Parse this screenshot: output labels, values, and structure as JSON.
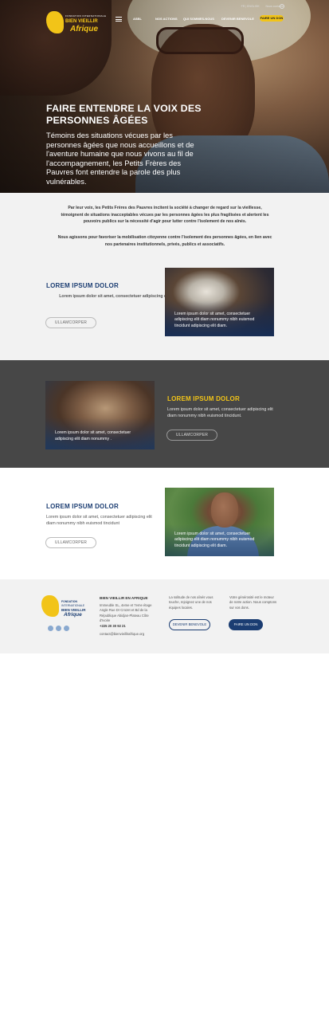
{
  "header": {
    "top_links": [
      "FR | ENGLISH",
      "Nous contacter"
    ],
    "logo": {
      "line1": "FONDATION INTERNATIONALE",
      "line2": "BIEN VIEILLIR",
      "line3": "Afrique"
    },
    "nav": [
      "ASBL",
      "NOS ACTIONS",
      "QUI SOMMES-NOUS",
      "DEVENIR BENEVOLE"
    ],
    "cta": "FAIRE UN DON"
  },
  "hero": {
    "title": "FAIRE ENTENDRE LA VOIX DES PERSONNES ÂGÉES",
    "text": "Témoins des situations vécues par les personnes âgées que nous accueillons et de l'aventure humaine que nous vivons au fil de l'accompagnement, les Petits Frères des Pauvres font entendre la parole des plus vulnérables."
  },
  "intro": {
    "p1": "Par leur voix, les Petits Frères des Pauvres incitent la société à changer de regard sur la vieillesse, témoignent de situations inacceptables vécues par les personnes âgées les plus fragilisées et alertent les pouvoirs publics sur la nécessité d'agir pour lutter contre l'isolement de nos aînés.",
    "p2": "Nous agissons pour favoriser la mobilisation citoyenne contre l'isolement des personnes âgées, en lien avec nos partenaires institutionnels, privés, publics et associatifs."
  },
  "sections": [
    {
      "title": "LOREM IPSUM DOLOR",
      "text": "Lorem ipsum dolor sit amet, consectetuer adipiscing elit diam nonummy nibh euismod tincidunt",
      "button": "ULLAMCORPER",
      "caption": "Lorem ipsum dolor sit amet, consectetuer adipiscing elit diam nonummy nibh euismod tincidunt adipiscing elit diam."
    },
    {
      "title": "LOREM IPSUM DOLOR",
      "text": "Lorem ipsum dolor sit amet, consectetuer adipiscing elit diam nonummy nibh euismod tincidunt.",
      "button": "ULLAMCORPER",
      "caption": "Lorem ipsum dolor sit amet, consectetuer adipiscing elit diam nonummy ."
    },
    {
      "title": "LOREM IPSUM DOLOR",
      "text": "Lorem ipsum dolor sit amet, consectetuer adipiscing elit diam nonummy nibh euismod tincidunt",
      "button": "ULLAMCORPER",
      "caption": "Lorem ipsum dolor sit amet, consectetuer adipiscing elit diam nonummy nibh euismod tincidunt adipiscing elit diam."
    }
  ],
  "footer": {
    "logo": {
      "line1": "FONDATION",
      "line1b": "INTERNATIONALE",
      "line2": "BIEN VIEILLIR",
      "line3": "Afrique"
    },
    "name": "BIEN VIEILLIR EN AFRIQUE",
    "address": "Immeuble SL, 4eme et 7eme étage Angle Rue Dr Crozet et Bd de la République Abidjan-Plateau Côte d'Ivoire",
    "phone": "+225 20 30 92 21",
    "email": "contact@bienvieillirafrique.org",
    "col3": "La solitude de nos aînés vous touche, rejoignez une de nos équipes locales.",
    "volunteer_button": "DEVENIR BENEVOLE",
    "col4": "Votre générosité est le moteur de notre action. Nous comptons sur vos dons.",
    "donate_button": "FAIRE UN DON",
    "social_icons": [
      "twitter-icon",
      "instagram-icon",
      "facebook-icon"
    ]
  },
  "colors": {
    "accent_yellow": "#f2c418",
    "navy": "#1b3d72",
    "dark_section": "#474747"
  }
}
